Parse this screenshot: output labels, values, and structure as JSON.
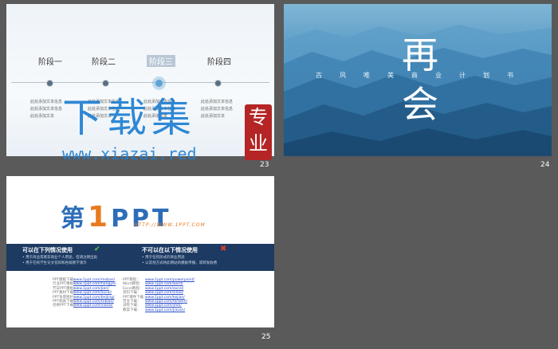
{
  "slides": [
    {
      "number": "23",
      "prefix": "",
      "stages": [
        "阶段一",
        "阶段二",
        "阶段三",
        "阶段四"
      ],
      "active_stage": 2,
      "stage_notes": [
        "此处添加文本信息 此处添加文本信息 此处添加文本",
        "此处添加文本信息 此处添加文本信息 此处添加文本",
        "此处添加文本信息 此处添加文本信息 此处添加文本",
        "此处添加文本信息 此处添加文本信息 此处添加文本"
      ],
      "watermark": {
        "text": "下载集",
        "url": "www.xiazai.red",
        "seal": "专业"
      }
    },
    {
      "number": "24",
      "prefix": "",
      "title_chars": [
        "再",
        "会"
      ],
      "subtitle": "古风唯美商业计划书"
    },
    {
      "number": "25",
      "logo": {
        "pre": "第",
        "one": "1",
        "post": "PPT",
        "url": "HTTP://WWW.1PPT.COM"
      },
      "can_use_heading": "可以在下列情况使用",
      "cannot_use_heading": "不可以在以下情况使用",
      "can_use_lines": [
        "• 用于商业或者非商业个人用途，但请注明出处",
        "• 用于在校学生论文答辩和各级教学演示"
      ],
      "cannot_use_lines": [
        "• 用于任何形式的商业用途",
        "• 以其他方式将此网站的模板传播，或转发收费"
      ],
      "links_left": [
        "PPT模板下载：",
        "行业PPT模板：",
        "节日PPT模板：",
        "PPT素材下载：",
        "PPT背景图片：",
        "PPT图表下载：",
        "优秀PPT下载："
      ],
      "urls_left": [
        "www.1ppt.com/moban/",
        "www.1ppt.com/hangye/",
        "www.1ppt.com/jieri/",
        "www.1ppt.com/sucai/",
        "www.1ppt.com/beijing/",
        "www.1ppt.com/tubiao/",
        "www.1ppt.com/xiazai/"
      ],
      "links_right": [
        "PPT教程：",
        "Word教程：",
        "Excel教程：",
        "资料下载：",
        "PPT课件下载：",
        "范文下载：",
        "试卷下载：",
        "教案下载："
      ],
      "urls_right": [
        "www.1ppt.com/powerpoint/",
        "www.1ppt.com/word/",
        "www.1ppt.com/excel/",
        "www.1ppt.com/ziliao/",
        "www.1ppt.com/kejian/",
        "www.1ppt.com/fanwen/",
        "www.1ppt.com/shiti/",
        "www.1ppt.com/jiaoan/"
      ]
    }
  ],
  "colors": {
    "background": "#5a5a5a",
    "accent_blue": "#1f7fd1",
    "band": "#1d3a63"
  }
}
